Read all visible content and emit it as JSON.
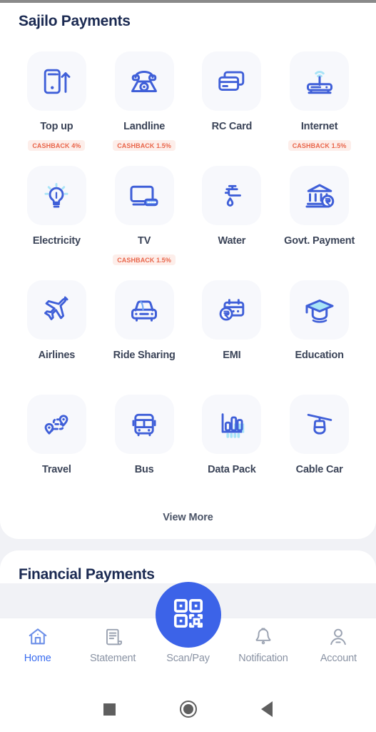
{
  "colors": {
    "primary_blue": "#3c63e8",
    "icon_blue": "#3f5fd8",
    "icon_light_blue": "#74a9f5",
    "icon_cyan": "#9fe0f7",
    "heading_navy": "#1b2a52",
    "label_gray": "#3b4458",
    "badge_text": "#e9664b",
    "badge_bg": "#fdeeea",
    "tile_bg": "#f7f8fc",
    "page_bg": "#f1f2f6",
    "nav_inactive": "#8a93a4"
  },
  "payments_card": {
    "title": "Sajilo Payments",
    "view_more_label": "View More",
    "services": [
      {
        "label": "Top up",
        "icon": "mobile-topup-icon",
        "badge": "CASHBACK 4%"
      },
      {
        "label": "Landline",
        "icon": "landline-phone-icon",
        "badge": "CASHBACK 1.5%"
      },
      {
        "label": "RC Card",
        "icon": "credit-cards-icon",
        "badge": ""
      },
      {
        "label": "Internet",
        "icon": "wifi-router-icon",
        "badge": "CASHBACK 1.5%"
      },
      {
        "label": "Electricity",
        "icon": "light-bulb-icon",
        "badge": ""
      },
      {
        "label": "TV",
        "icon": "television-icon",
        "badge": "CASHBACK 1.5%"
      },
      {
        "label": "Water",
        "icon": "water-tap-icon",
        "badge": ""
      },
      {
        "label": "Govt. Payment",
        "icon": "government-bank-icon",
        "badge": ""
      },
      {
        "label": "Airlines",
        "icon": "airplane-icon",
        "badge": ""
      },
      {
        "label": "Ride Sharing",
        "icon": "car-icon",
        "badge": ""
      },
      {
        "label": "EMI",
        "icon": "calendar-rupee-icon",
        "badge": ""
      },
      {
        "label": "Education",
        "icon": "graduation-cap-icon",
        "badge": ""
      },
      {
        "label": "Travel",
        "icon": "route-map-icon",
        "badge": ""
      },
      {
        "label": "Bus",
        "icon": "bus-icon",
        "badge": ""
      },
      {
        "label": "Data Pack",
        "icon": "bar-chart-icon",
        "badge": ""
      },
      {
        "label": "Cable Car",
        "icon": "cable-car-icon",
        "badge": ""
      }
    ]
  },
  "financial_card": {
    "title": "Financial Payments"
  },
  "bottom_nav": {
    "items": [
      {
        "label": "Home",
        "icon": "home-icon",
        "active": true
      },
      {
        "label": "Statement",
        "icon": "statement-icon",
        "active": false
      },
      {
        "label": "Scan/Pay",
        "icon": "qr-scan-icon",
        "active": false
      },
      {
        "label": "Notification",
        "icon": "bell-icon",
        "active": false
      },
      {
        "label": "Account",
        "icon": "person-icon",
        "active": false
      }
    ],
    "fab_icon": "qr-code-icon"
  },
  "system_nav": {
    "recents": "recents-square-button",
    "home": "home-circle-button",
    "back": "back-triangle-button"
  }
}
